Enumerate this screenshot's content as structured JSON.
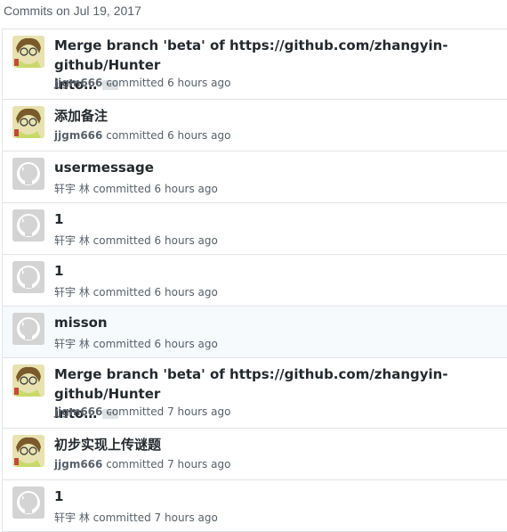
{
  "header": {
    "title": "Commits on Jul 19, 2017"
  },
  "commits": [
    {
      "title_line1": "Merge branch 'beta' of https://github.com/zhangyin-github/Hunter",
      "title_line2": "into…",
      "ellipsis": "…",
      "author": "jjgm666",
      "verb": "committed",
      "time": "6 hours ago",
      "avatar": "anime-avatar"
    },
    {
      "title_line1": "添加备注",
      "author": "jjgm666",
      "verb": "committed",
      "time": "6 hours ago",
      "avatar": "anime-avatar"
    },
    {
      "title_line1": "usermessage",
      "author": "轩宇 林",
      "verb": "committed",
      "time": "6 hours ago",
      "avatar": "github-octocat-avatar"
    },
    {
      "title_line1": "1",
      "author": "轩宇 林",
      "verb": "committed",
      "time": "6 hours ago",
      "avatar": "github-octocat-avatar"
    },
    {
      "title_line1": "1",
      "author": "轩宇 林",
      "verb": "committed",
      "time": "6 hours ago",
      "avatar": "github-octocat-avatar"
    },
    {
      "title_line1": "misson",
      "author": "轩宇 林",
      "verb": "committed",
      "time": "6 hours ago",
      "avatar": "github-octocat-avatar"
    },
    {
      "title_line1": "Merge branch 'beta' of https://github.com/zhangyin-github/Hunter",
      "title_line2": "into…",
      "ellipsis": "…",
      "author": "jjgm666",
      "verb": "committed",
      "time": "7 hours ago",
      "avatar": "anime-avatar"
    },
    {
      "title_line1": "初步实现上传谜题",
      "author": "jjgm666",
      "verb": "committed",
      "time": "7 hours ago",
      "avatar": "anime-avatar"
    },
    {
      "title_line1": "1",
      "author": "轩宇 林",
      "verb": "committed",
      "time": "7 hours ago",
      "avatar": "github-octocat-avatar"
    }
  ]
}
